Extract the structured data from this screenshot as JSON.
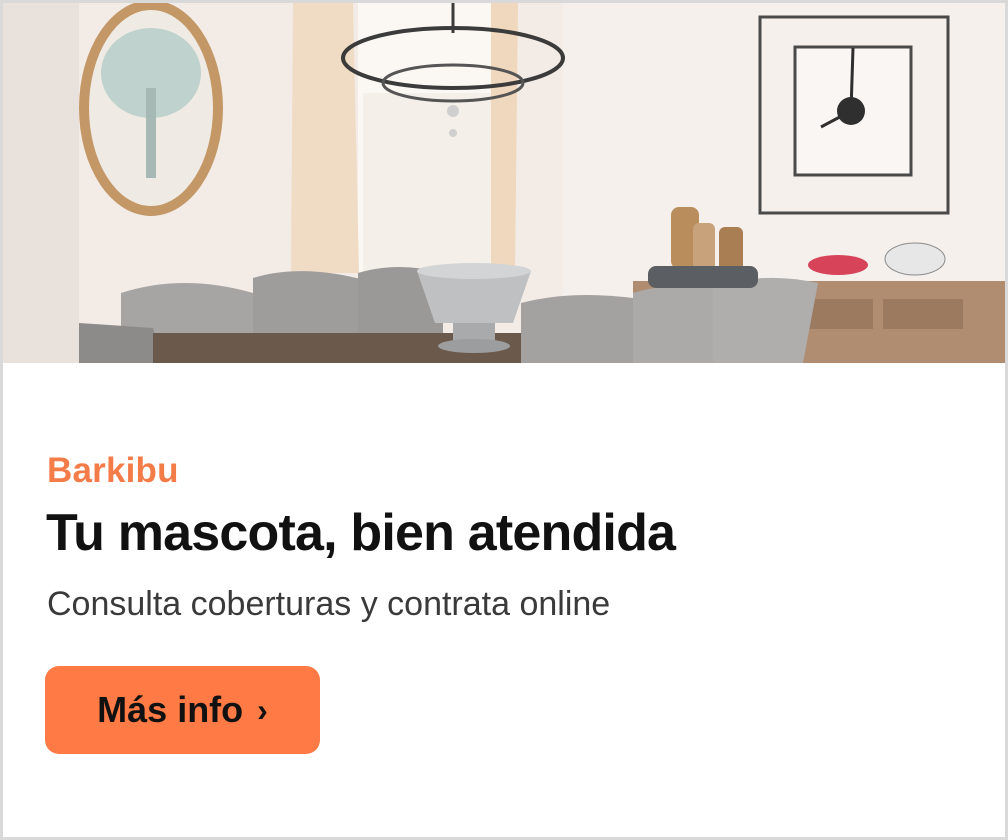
{
  "ad": {
    "brand": "Barkibu",
    "headline": "Tu mascota, bien atendida",
    "subheadline": "Consulta coberturas y contrata online",
    "cta_label": "Más info",
    "cta_chevron": "›"
  },
  "image": {
    "description_icon": "dining-room-photo"
  },
  "colors": {
    "accent": "#ff7a45",
    "brand_text": "#f47c48",
    "headline_text": "#111111",
    "subline_text": "#3a3a3a",
    "border": "#d9d9d9"
  }
}
